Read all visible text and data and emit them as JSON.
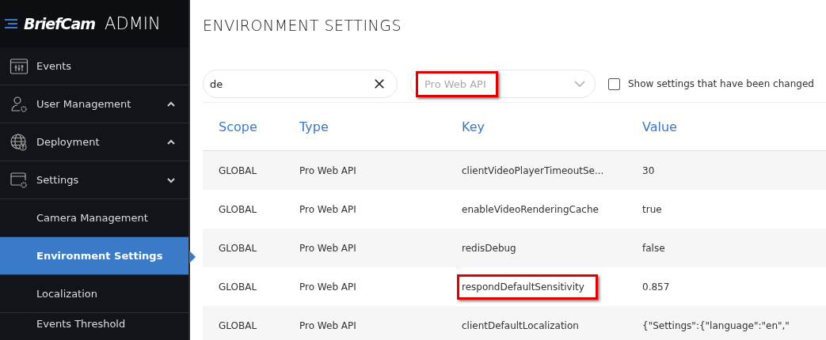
{
  "brand": {
    "logo": "BriefCam",
    "title": "ADMIN"
  },
  "sidebar": {
    "items": [
      {
        "label": "Events",
        "kind": "link",
        "selected": false
      },
      {
        "label": "User Management",
        "kind": "group",
        "expanded": false,
        "selected": false
      },
      {
        "label": "Deployment",
        "kind": "group",
        "expanded": false,
        "selected": false
      },
      {
        "label": "Settings",
        "kind": "group",
        "expanded": true,
        "selected": false
      },
      {
        "label": "Camera Management",
        "kind": "subitem",
        "selected": false
      },
      {
        "label": "Environment Settings",
        "kind": "subitem",
        "selected": true
      },
      {
        "label": "Localization",
        "kind": "subitem",
        "selected": false
      },
      {
        "label": "Events Threshold",
        "kind": "subitem",
        "selected": false
      }
    ]
  },
  "page_title": "ENVIRONMENT SETTINGS",
  "filters": {
    "search": {
      "value": "de"
    },
    "type_select": {
      "placeholder": "Pro Web API",
      "highlighted": true
    },
    "changed_only": {
      "label": "Show settings that have been changed",
      "checked": false
    }
  },
  "table": {
    "columns": [
      "Scope",
      "Type",
      "Key",
      "Value"
    ],
    "rows": [
      {
        "scope": "GLOBAL",
        "type": "Pro Web API",
        "key": "clientVideoPlayerTimeoutSe...",
        "value": "30",
        "key_highlighted": false
      },
      {
        "scope": "GLOBAL",
        "type": "Pro Web API",
        "key": "enableVideoRenderingCache",
        "value": "true",
        "key_highlighted": false
      },
      {
        "scope": "GLOBAL",
        "type": "Pro Web API",
        "key": "redisDebug",
        "value": "false",
        "key_highlighted": false
      },
      {
        "scope": "GLOBAL",
        "type": "Pro Web API",
        "key": "respondDefaultSensitivity",
        "value": "0.857",
        "key_highlighted": true
      },
      {
        "scope": "GLOBAL",
        "type": "Pro Web API",
        "key": "clientDefaultLocalization",
        "value": "{\"Settings\":{\"language\":\"en\",\"",
        "key_highlighted": false
      }
    ]
  }
}
